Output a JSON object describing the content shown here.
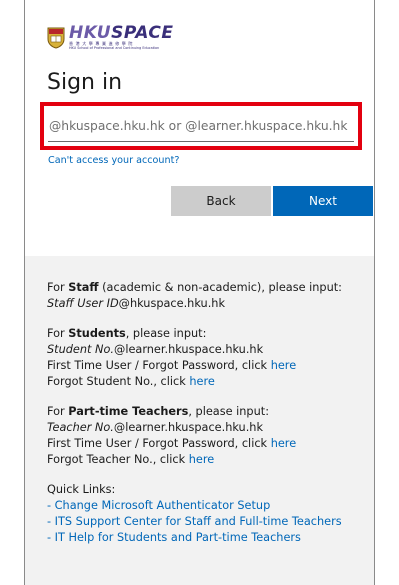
{
  "brand": {
    "logo_word_a": "HKU",
    "logo_word_b": "SPACE",
    "logo_cn": "香港大學專業進修學院",
    "logo_en": "HKU School of Professional and Continuing Education"
  },
  "title": "Sign in",
  "input": {
    "placeholder": "@hkuspace.hku.hk or @learner.hkuspace.hku.hk",
    "value": ""
  },
  "cant_access": "Can't access your account?",
  "buttons": {
    "back": "Back",
    "next": "Next"
  },
  "colors": {
    "accent": "#0067b8",
    "highlight": "#e3000f",
    "panel": "#f2f2f2"
  },
  "info": {
    "staff": {
      "prefix": "For ",
      "role": "Staff",
      "suffix": " (academic & non-academic), please input:",
      "id_italic": "Staff User ID",
      "id_domain": "@hkuspace.hku.hk"
    },
    "students": {
      "prefix": "For ",
      "role": "Students",
      "suffix": ", please input:",
      "id_italic": "Student No.",
      "id_domain": "@learner.hkuspace.hku.hk",
      "line2": "First Time User / Forgot Password, click ",
      "line3": "Forgot Student No., click ",
      "link": "here"
    },
    "teachers": {
      "prefix": "For ",
      "role": "Part-time Teachers",
      "suffix": ", please input:",
      "id_italic": "Teacher No.",
      "id_domain": "@learner.hkuspace.hku.hk",
      "line2": "First Time User / Forgot Password, click ",
      "line3": "Forgot Teacher No., click ",
      "link": "here"
    },
    "quick_links": {
      "heading": "Quick Links:",
      "items": [
        "- Change Microsoft Authenticator Setup",
        "- ITS Support Center for Staff and Full-time Teachers",
        "- IT Help for Students and Part-time Teachers"
      ]
    }
  }
}
